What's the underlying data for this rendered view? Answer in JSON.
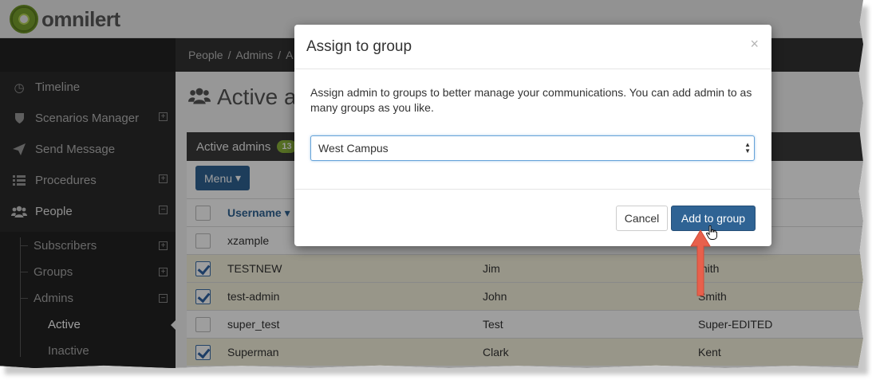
{
  "brand": {
    "name": "omnilert"
  },
  "colors": {
    "primary": "#2f6394",
    "accent_arrow": "#e8604c",
    "selected_row": "#f6f3dd",
    "badge": "#8cb33a"
  },
  "sidebar": {
    "items": [
      {
        "label": "Timeline",
        "icon": "clock-icon"
      },
      {
        "label": "Scenarios Manager",
        "icon": "shield-icon",
        "expander": "⊞"
      },
      {
        "label": "Send Message",
        "icon": "paper-plane-icon"
      },
      {
        "label": "Procedures",
        "icon": "list-icon",
        "expander": "⊞"
      },
      {
        "label": "People",
        "icon": "users-icon",
        "expander": "⊟"
      }
    ],
    "people_children": [
      {
        "label": "Subscribers",
        "expander": "⊞"
      },
      {
        "label": "Groups",
        "expander": "⊞"
      },
      {
        "label": "Admins",
        "expander": "⊟"
      }
    ],
    "admins_children": [
      {
        "label": "Active"
      },
      {
        "label": "Inactive"
      }
    ]
  },
  "breadcrumb": [
    "People",
    "Admins",
    "A"
  ],
  "page": {
    "title": "Active adm"
  },
  "panel": {
    "title": "Active admins",
    "count": "13",
    "menu_label": "Menu"
  },
  "table": {
    "header": {
      "username": "Username"
    },
    "rows": [
      {
        "username": "xzample",
        "first": "",
        "last": "",
        "checked": false
      },
      {
        "username": "TESTNEW",
        "first": "Jim",
        "last": "mith",
        "checked": true
      },
      {
        "username": "test-admin",
        "first": "John",
        "last": "Smith",
        "checked": true
      },
      {
        "username": "super_test",
        "first": "Test",
        "last": "Super-EDITED",
        "checked": false
      },
      {
        "username": "Superman",
        "first": "Clark",
        "last": "Kent",
        "checked": true
      }
    ]
  },
  "modal": {
    "title": "Assign to group",
    "close": "×",
    "description": "Assign admin to groups to better manage your communications. You can add admin to as many groups as you like.",
    "select_value": "West Campus",
    "cancel_label": "Cancel",
    "submit_label": "Add to group"
  }
}
